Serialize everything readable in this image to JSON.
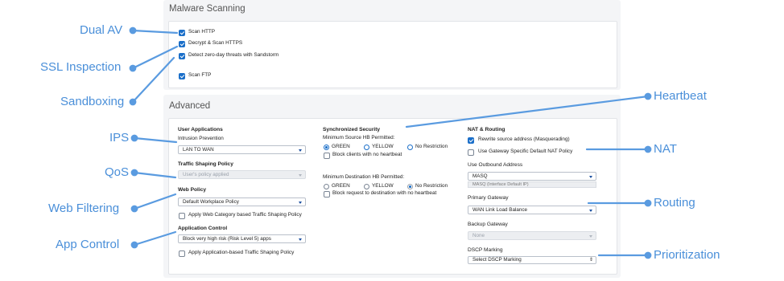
{
  "malware": {
    "title": "Malware Scanning",
    "items": [
      {
        "label": "Scan HTTP",
        "checked": true
      },
      {
        "label": "Decrypt & Scan HTTPS",
        "checked": true
      },
      {
        "label": "Detect zero-day threats with Sandstorm",
        "checked": true
      },
      {
        "label": "Scan FTP",
        "checked": true
      }
    ]
  },
  "advanced": {
    "title": "Advanced",
    "user_apps": {
      "heading": "User Applications",
      "ips_label": "Intrusion Prevention",
      "ips_value": "LAN TO WAN",
      "traffic_label": "Traffic Shaping Policy",
      "traffic_value": "User's policy applied",
      "web_label": "Web Policy",
      "web_value": "Default Workplace Policy",
      "web_category_cb": "Apply Web Category based Traffic Shaping Policy",
      "app_label": "Application Control",
      "app_value": "Block very high risk (Risk Level 5) apps",
      "app_cb": "Apply Application-based Traffic Shaping Policy"
    },
    "sync": {
      "heading": "Synchronized Security",
      "min_source": "Minimum Source HB Permitted:",
      "min_dest": "Minimum Destination HB Permitted:",
      "green": "GREEN",
      "yellow": "YELLOW",
      "no_restriction": "No Restriction",
      "block_clients": "Block clients with no heartbeat",
      "block_request": "Block request to destination with no heartbeat"
    },
    "nat": {
      "heading": "NAT & Routing",
      "rewrite": "Rewrite source address (Masquerading)",
      "gateway_nat": "Use Gateway Specific Default NAT Policy",
      "outbound_label": "Use Outbound Address",
      "outbound_value": "MASQ",
      "outbound_hint": "MASQ (Interface Default IP)",
      "primary_label": "Primary Gateway",
      "primary_value": "WAN Link Load Balance",
      "backup_label": "Backup Gateway",
      "backup_value": "None",
      "dscp_label": "DSCP Marking",
      "dscp_value": "Select DSCP Marking"
    }
  },
  "annotations": {
    "dual_av": "Dual AV",
    "ssl": "SSL Inspection",
    "sandboxing": "Sandboxing",
    "ips": "IPS",
    "qos": "QoS",
    "web_filtering": "Web Filtering",
    "app_control": "App Control",
    "heartbeat": "Heartbeat",
    "nat": "NAT",
    "routing": "Routing",
    "prioritization": "Prioritization"
  },
  "colors": {
    "annotation": "#4a8fd9",
    "checkbox": "#1b6fc9"
  }
}
